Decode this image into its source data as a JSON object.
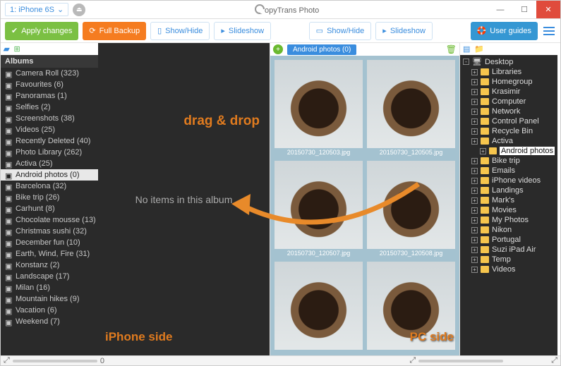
{
  "titlebar": {
    "device": "1: iPhone 6S",
    "appname": "opyTrans Photo"
  },
  "toolbar": {
    "apply": "Apply changes",
    "backup": "Full Backup",
    "showhide": "Show/Hide",
    "slideshow": "Slideshow",
    "showhide2": "Show/Hide",
    "slideshow2": "Slideshow",
    "guides": "User guides"
  },
  "albums": {
    "title": "Albums",
    "items": [
      {
        "label": "Camera Roll (323)"
      },
      {
        "label": "Favourites (6)"
      },
      {
        "label": "Panoramas (1)"
      },
      {
        "label": "Selfies (2)"
      },
      {
        "label": "Screenshots (38)"
      },
      {
        "label": "Videos (25)"
      },
      {
        "label": "Recently Deleted (40)"
      },
      {
        "label": "Photo Library (262)"
      },
      {
        "label": "Activa (25)"
      },
      {
        "label": "Android photos (0)",
        "sel": true
      },
      {
        "label": "Barcelona (32)"
      },
      {
        "label": "Bike trip (26)"
      },
      {
        "label": "Carhunt (8)"
      },
      {
        "label": "Chocolate mousse (13)"
      },
      {
        "label": "Christmas sushi (32)"
      },
      {
        "label": "December fun (10)"
      },
      {
        "label": "Earth, Wind, Fire (31)"
      },
      {
        "label": "Konstanz (2)"
      },
      {
        "label": "Landscape (17)"
      },
      {
        "label": "Milan (16)"
      },
      {
        "label": "Mountain hikes (9)"
      },
      {
        "label": "Vacation (6)"
      },
      {
        "label": "Weekend (7)"
      }
    ]
  },
  "left": {
    "empty": "No items in this album",
    "count": "0"
  },
  "overlay": {
    "drag": "drag & drop",
    "iphone": "iPhone side",
    "pc": "PC side"
  },
  "right": {
    "chip": "Android photos (0)",
    "thumbs": [
      {
        "cap": "20150730_120503.jpg"
      },
      {
        "cap": "20150730_120505.jpg"
      },
      {
        "cap": "20150730_120507.jpg"
      },
      {
        "cap": "20150730_120508.jpg"
      },
      {
        "cap": ""
      },
      {
        "cap": ""
      }
    ]
  },
  "tree": {
    "root": "Desktop",
    "nodes": [
      {
        "l": "Libraries",
        "i": 1
      },
      {
        "l": "Homegroup",
        "i": 1
      },
      {
        "l": "Krasimir",
        "i": 1
      },
      {
        "l": "Computer",
        "i": 1
      },
      {
        "l": "Network",
        "i": 1
      },
      {
        "l": "Control Panel",
        "i": 1
      },
      {
        "l": "Recycle Bin",
        "i": 1
      },
      {
        "l": "Activa",
        "i": 1
      },
      {
        "l": "Android photos",
        "i": 2,
        "sel": true
      },
      {
        "l": "Bike trip",
        "i": 1
      },
      {
        "l": "Emails",
        "i": 1
      },
      {
        "l": "iPhone videos",
        "i": 1
      },
      {
        "l": "Landings",
        "i": 1
      },
      {
        "l": "Mark's",
        "i": 1
      },
      {
        "l": "Movies",
        "i": 1
      },
      {
        "l": "My Photos",
        "i": 1
      },
      {
        "l": "Nikon",
        "i": 1
      },
      {
        "l": "Portugal",
        "i": 1
      },
      {
        "l": "Suzi iPad Air",
        "i": 1
      },
      {
        "l": "Temp",
        "i": 1
      },
      {
        "l": "Videos",
        "i": 1
      }
    ]
  }
}
